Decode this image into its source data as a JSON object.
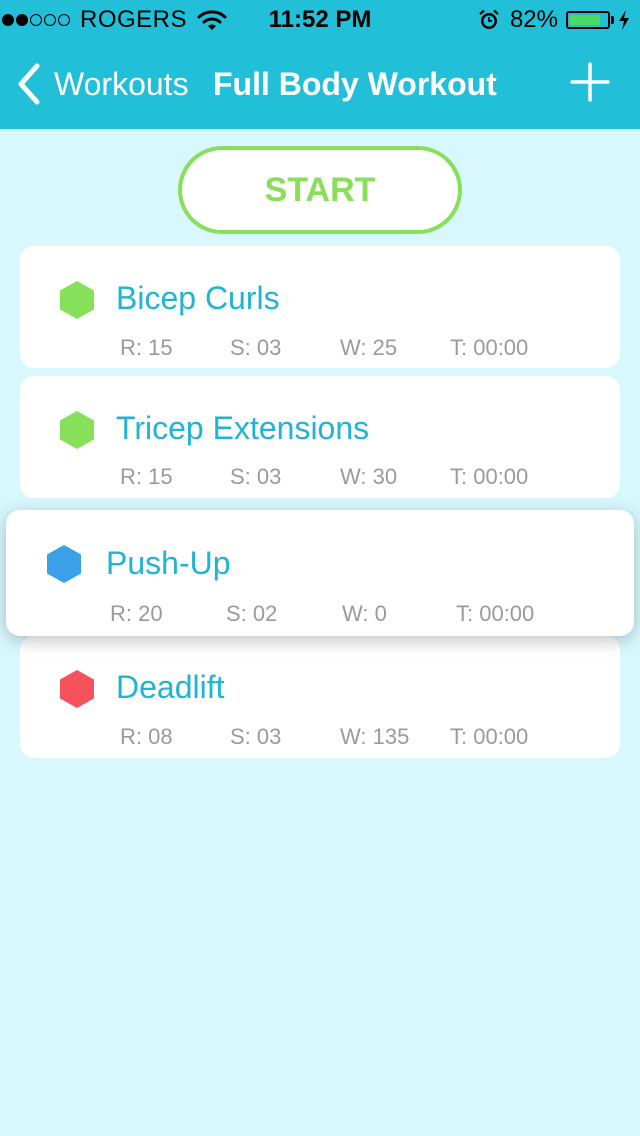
{
  "status_bar": {
    "signal_dots_filled": 2,
    "signal_dots_total": 5,
    "carrier": "ROGERS",
    "time": "11:52 PM",
    "battery_percent": "82%",
    "battery_level": 0.82,
    "icons": [
      "wifi-icon",
      "alarm-icon",
      "battery-icon",
      "charging-bolt-icon"
    ]
  },
  "nav": {
    "back_label": "Workouts",
    "title": "Full Body Workout",
    "back_icon": "chevron-left-icon",
    "add_icon": "plus-icon"
  },
  "start_label": "START",
  "exercises": [
    {
      "name": "Bicep Curls",
      "color": "#86e05a",
      "reps": "R: 15",
      "sets": "S: 03",
      "weight": "W: 25",
      "time": "T: 00:00"
    },
    {
      "name": "Tricep Extensions",
      "color": "#86e05a",
      "reps": "R: 15",
      "sets": "S: 03",
      "weight": "W: 30",
      "time": "T: 00:00"
    },
    {
      "name": "Push-Up",
      "color": "#3aa0e8",
      "reps": "R: 20",
      "sets": "S: 02",
      "weight": "W: 0",
      "time": "T: 00:00"
    },
    {
      "name": "Deadlift",
      "color": "#f5525c",
      "reps": "R: 08",
      "sets": "S: 03",
      "weight": "W: 135",
      "time": "T: 00:00"
    }
  ],
  "colors": {
    "header": "#22bfd9",
    "background": "#d9f8fe",
    "accent_green": "#86e05a",
    "title_blue": "#1fb4d3",
    "stat_gray": "#9a9a9a"
  }
}
